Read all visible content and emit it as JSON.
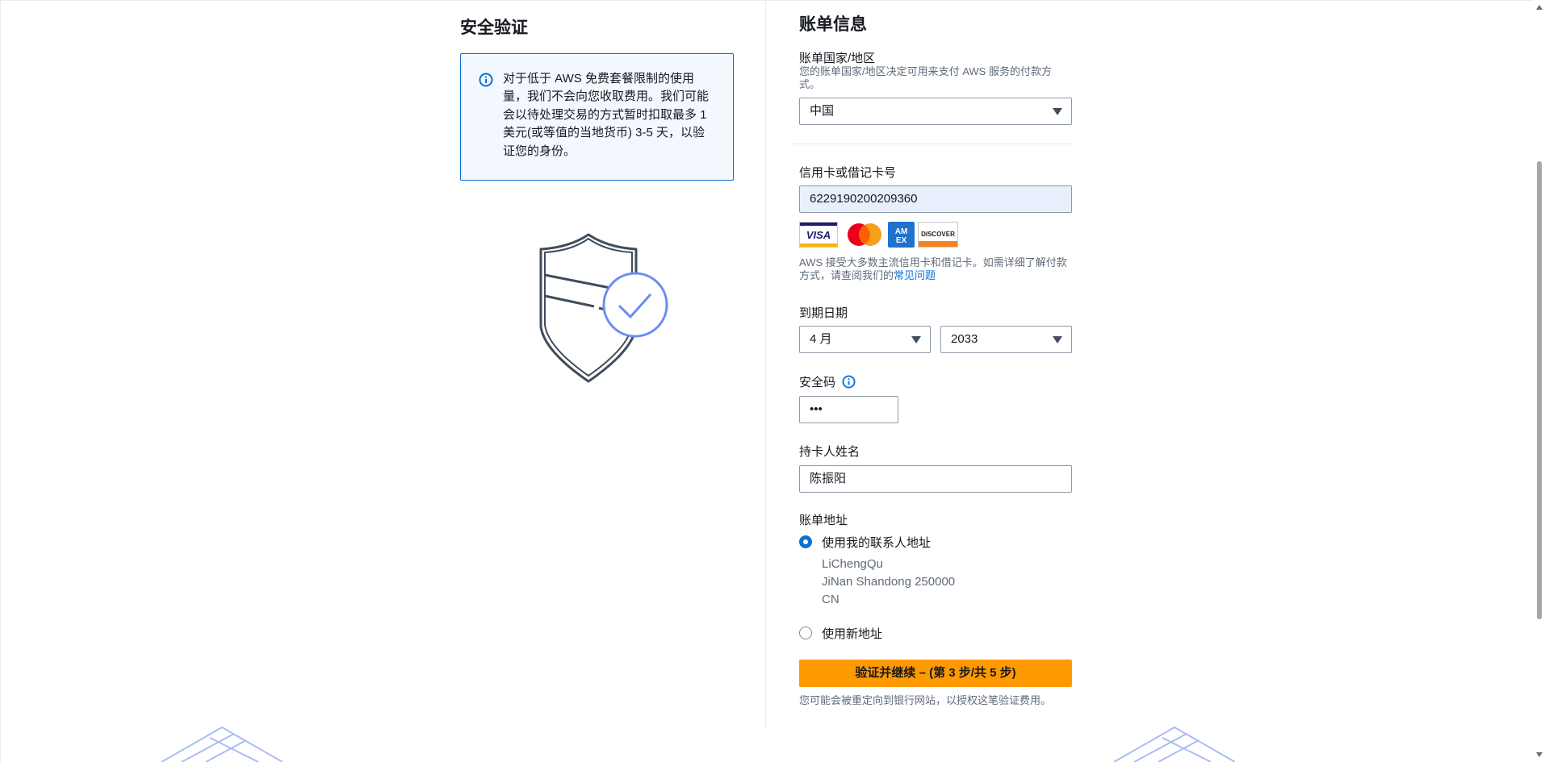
{
  "left": {
    "title": "安全验证",
    "info_text": "对于低于 AWS 免费套餐限制的使用量，我们不会向您收取费用。我们可能会以待处理交易的方式暂时扣取最多 1 美元(或等值的当地货币) 3-5 天，以验证您的身份。"
  },
  "right": {
    "title": "账单信息",
    "country": {
      "label": "账单国家/地区",
      "description": "您的账单国家/地区决定可用来支付 AWS 服务的付款方式。",
      "value": "中国"
    },
    "card": {
      "label": "信用卡或借记卡号",
      "value": "6229190200209360",
      "brands": [
        "VISA",
        "Mastercard",
        "AMEX",
        "DISCOVER"
      ],
      "note_prefix": "AWS 接受大多数主流信用卡和借记卡。如需详细了解付款方式，请查阅我们的",
      "faq_link": "常见问题"
    },
    "expiry": {
      "label": "到期日期",
      "month": "4 月",
      "year": "2033"
    },
    "cvv": {
      "label": "安全码",
      "value": "•••"
    },
    "holder": {
      "label": "持卡人姓名",
      "value": "陈振阳"
    },
    "address": {
      "label": "账单地址",
      "option_contact": "使用我的联系人地址",
      "lines": [
        "LiChengQu",
        "JiNan Shandong 250000",
        "CN"
      ],
      "option_new": "使用新地址"
    },
    "submit_label": "验证并继续 – (第 3 步/共 5 步)",
    "redirect_note": "您可能会被重定向到银行网站，以授权这笔验证费用。"
  },
  "colors": {
    "accent": "#0972d3",
    "primary_button": "#ff9900",
    "info_bg": "#f2f8fd",
    "autofill_bg": "#e8f0fe"
  }
}
